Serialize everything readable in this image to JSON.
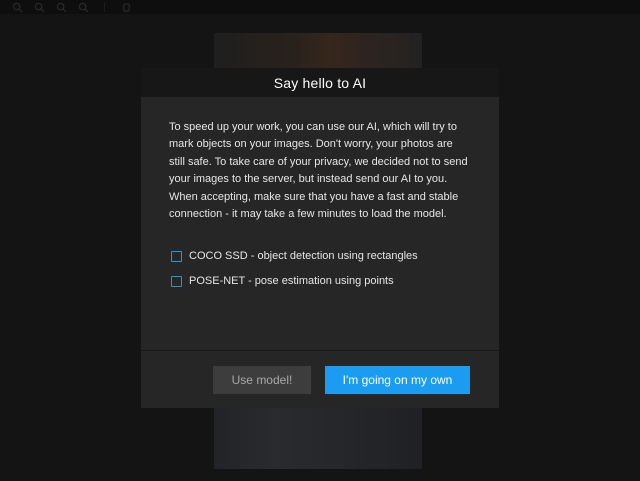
{
  "modal": {
    "title": "Say hello to AI",
    "description": "To speed up your work, you can use our AI, which will try to mark objects on your images. Don't worry, your photos are still safe. To take care of your privacy, we decided not to send your images to the server, but instead send our AI to you. When accepting, make sure that you have a fast and stable connection - it may take a few minutes to load the model.",
    "options": [
      {
        "label": "COCO SSD - object detection using rectangles",
        "checked": false
      },
      {
        "label": "POSE-NET - pose estimation using points",
        "checked": false
      }
    ],
    "buttons": {
      "use_model": "Use model!",
      "own": "I'm going on my own"
    }
  },
  "toolbar": {
    "icons": [
      "zoom-in-icon",
      "zoom-out-icon",
      "zoom-fit-icon",
      "zoom-max-icon",
      "pan-hand-icon"
    ]
  },
  "colors": {
    "accent": "#1a9cf0",
    "modal_bg": "#262626",
    "header_bg": "#171717",
    "disabled_button": "#3d3d3d"
  }
}
